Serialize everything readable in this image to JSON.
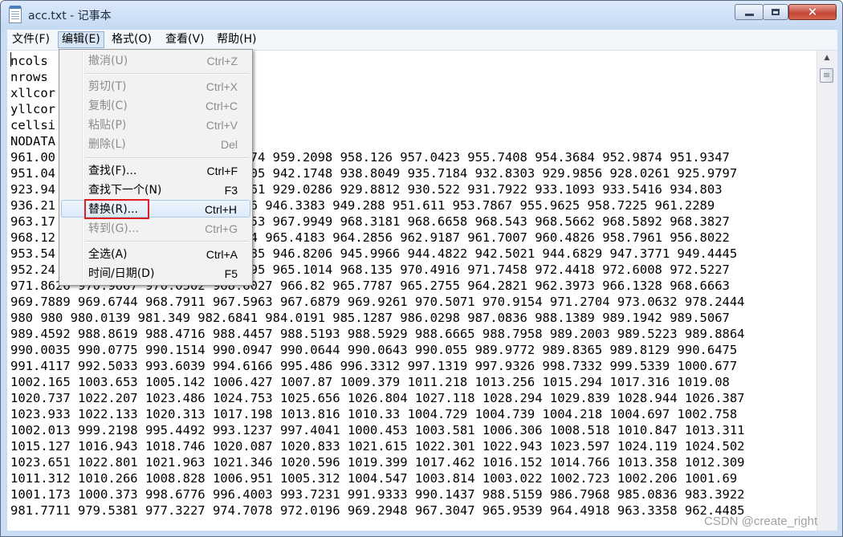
{
  "window": {
    "title": "acc.txt - 记事本",
    "minimize_icon": "minimize-icon",
    "maximize_icon": "maximize-icon",
    "close_icon": "close-icon",
    "close_glyph": "✕"
  },
  "menubar": {
    "items": [
      "文件(F)",
      "编辑(E)",
      "格式(O)",
      "查看(V)",
      "帮助(H)"
    ],
    "active": "编辑(E)"
  },
  "edit_menu": {
    "undo": {
      "label": "撤消(U)",
      "shortcut": "Ctrl+Z",
      "enabled": false
    },
    "cut": {
      "label": "剪切(T)",
      "shortcut": "Ctrl+X",
      "enabled": false
    },
    "copy": {
      "label": "复制(C)",
      "shortcut": "Ctrl+C",
      "enabled": false
    },
    "paste": {
      "label": "粘贴(P)",
      "shortcut": "Ctrl+V",
      "enabled": false
    },
    "delete": {
      "label": "删除(L)",
      "shortcut": "Del",
      "enabled": false
    },
    "find": {
      "label": "查找(F)...",
      "shortcut": "Ctrl+F",
      "enabled": true
    },
    "find_next": {
      "label": "查找下一个(N)",
      "shortcut": "F3",
      "enabled": true
    },
    "replace": {
      "label": "替换(R)...",
      "shortcut": "Ctrl+H",
      "enabled": true,
      "hovered": true
    },
    "goto": {
      "label": "转到(G)...",
      "shortcut": "Ctrl+G",
      "enabled": false
    },
    "select_all": {
      "label": "全选(A)",
      "shortcut": "Ctrl+A",
      "enabled": true
    },
    "time_date": {
      "label": "时间/日期(D)",
      "shortcut": "F5",
      "enabled": true
    }
  },
  "highlight_color": "#e02020",
  "editor": {
    "lines": [
      "ncols",
      "nrows",
      "xllcor",
      "yllcor",
      "cellsi",
      "NODATA",
      "961.00                       .1174 959.2098 958.126 957.0423 955.7408 954.3684 952.9874 951.9347",
      "951.04                       .2205 942.1748 938.8049 935.7184 932.8303 929.9856 928.0261 925.9797",
      "923.94                       .8361 929.0286 929.8812 930.522 931.7922 933.1093 933.5416 934.803",
      "936.21                       .406 946.3383 949.288 951.611 953.7867 955.9625 958.7225 961.2289",
      "963.17                       .3553 967.9949 968.3181 968.6658 968.543 968.5662 968.5892 968.3827",
      "968.12                       4554 965.4183 964.2856 962.9187 961.7007 960.4826 958.7961 956.8022",
      "953.54                       .6085 946.8206 945.9966 944.4822 942.5021 944.6829 947.3771 949.4445",
      "952.24                       .7195 965.1014 968.135 970.4916 971.7458 972.4418 972.6008 972.5227",
      "971.8626 970.9667 970.0502 968.6027 966.82 965.7787 965.2755 964.2821 962.3973 966.1328 968.6663",
      "969.7889 969.6744 968.7911 967.5963 967.6879 969.9261 970.5071 970.9154 971.2704 973.0632 978.2444",
      "980 980 980.0139 981.349 982.6841 984.0191 985.1287 986.0298 987.0836 988.1389 989.1942 989.5067",
      "989.4592 988.8619 988.4716 988.4457 988.5193 988.5929 988.6665 988.7958 989.2003 989.5223 989.8864",
      "990.0035 990.0775 990.1514 990.0947 990.0644 990.0643 990.055 989.9772 989.8365 989.8129 990.6475",
      "991.4117 992.5033 993.6039 994.6166 995.486 996.3312 997.1319 997.9326 998.7332 999.5339 1000.677",
      "1002.165 1003.653 1005.142 1006.427 1007.87 1009.379 1011.218 1013.256 1015.294 1017.316 1019.08",
      "1020.737 1022.207 1023.486 1024.753 1025.656 1026.804 1027.118 1028.294 1029.839 1028.944 1026.387",
      "1023.933 1022.133 1020.313 1017.198 1013.816 1010.33 1004.729 1004.739 1004.218 1004.697 1002.758",
      "1002.013 999.2198 995.4492 993.1237 997.4041 1000.453 1003.581 1006.306 1008.518 1010.847 1013.311",
      "1015.127 1016.943 1018.746 1020.087 1020.833 1021.615 1022.301 1022.943 1023.597 1024.119 1024.502",
      "1023.651 1022.801 1021.963 1021.346 1020.596 1019.399 1017.462 1016.152 1014.766 1013.358 1012.309",
      "1011.312 1010.266 1008.828 1006.951 1005.312 1004.547 1003.814 1003.022 1002.723 1002.206 1001.69",
      "1001.173 1000.373 998.6776 996.4003 993.7231 991.9333 990.1437 988.5159 986.7968 985.0836 983.3922",
      "981.7711 979.5381 977.3227 974.7078 972.0196 969.2948 967.3047 965.9539 964.4918 963.3358 962.4485"
    ]
  },
  "watermark": "CSDN @create_right"
}
